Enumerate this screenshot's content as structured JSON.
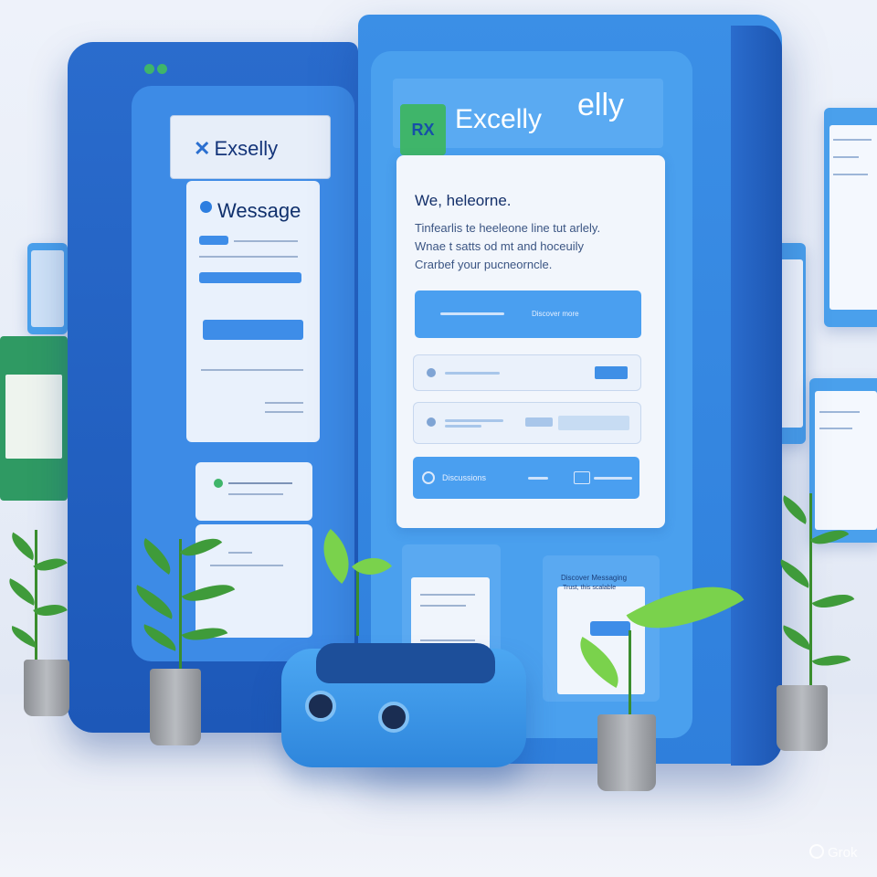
{
  "left_panel": {
    "brand": "Exselly",
    "card_title": "Wessage"
  },
  "right_panel": {
    "logo_mark": "RX",
    "brand": "Excelly",
    "brand_alt": "elly",
    "welcome": {
      "title": "We, heleorne.",
      "body_lines": [
        "Tinfearlis te heeleone line tut arlely.",
        "Wnae t satts od mt and hoceuily",
        "Crarbef your pucneorncle."
      ],
      "primary_button": "Discover more",
      "bottom_button": "Discussions"
    },
    "right_card_label": "Discover Messaging",
    "right_card_sublabel": "Trust, this scalable"
  },
  "watermark": "Grok",
  "colors": {
    "panel_dark": "#1d58b8",
    "panel_mid": "#3b8fe6",
    "card_bg": "#f2f6fc",
    "accent_green": "#3fb56a"
  }
}
